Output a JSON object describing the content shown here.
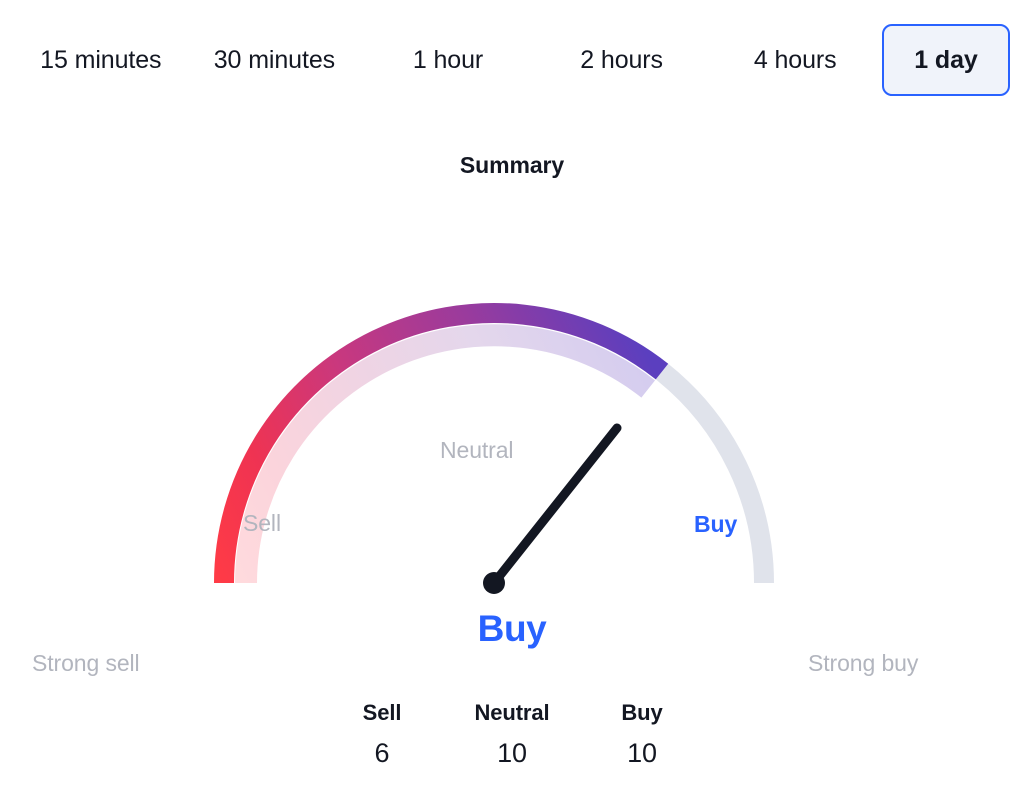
{
  "widget": {
    "title": "Summary"
  },
  "intervals": {
    "selected": "1 day",
    "items": [
      {
        "label": "15 minutes",
        "selected": false
      },
      {
        "label": "30 minutes",
        "selected": false
      },
      {
        "label": "1 hour",
        "selected": false
      },
      {
        "label": "2 hours",
        "selected": false
      },
      {
        "label": "4 hours",
        "selected": false
      },
      {
        "label": "1 day",
        "selected": true
      }
    ]
  },
  "gauge": {
    "scale_labels": {
      "strong_sell": "Strong sell",
      "sell": "Sell",
      "neutral": "Neutral",
      "buy": "Buy",
      "strong_buy": "Strong buy"
    },
    "active_label": "Buy",
    "result": "Buy",
    "needle_angle_deg": 51.5,
    "fill_fraction": 0.715,
    "colors": {
      "accent_blue": "#2962ff",
      "text_dark": "#131722",
      "label_gray": "#b2b5be",
      "track_gray": "#e0e3eb",
      "gradient_start": "#f7525f",
      "gradient_mid": "#c9387e",
      "gradient_end": "#5b3fbf"
    }
  },
  "counts": {
    "columns": [
      {
        "label": "Sell",
        "value": "6"
      },
      {
        "label": "Neutral",
        "value": "10"
      },
      {
        "label": "Buy",
        "value": "10"
      }
    ]
  },
  "chart_data": {
    "type": "gauge",
    "title": "Summary",
    "rating": "Buy",
    "categories": [
      "Strong sell",
      "Sell",
      "Neutral",
      "Buy",
      "Strong buy"
    ],
    "values": [
      6,
      10,
      10
    ],
    "series": [
      {
        "name": "Sell",
        "value": 6
      },
      {
        "name": "Neutral",
        "value": 10
      },
      {
        "name": "Buy",
        "value": 10
      }
    ],
    "needle_angle_deg": 51.5,
    "needle_position_fraction": 0.715,
    "axis_range_deg": [
      180,
      0
    ],
    "legend": "none",
    "grid": false
  }
}
